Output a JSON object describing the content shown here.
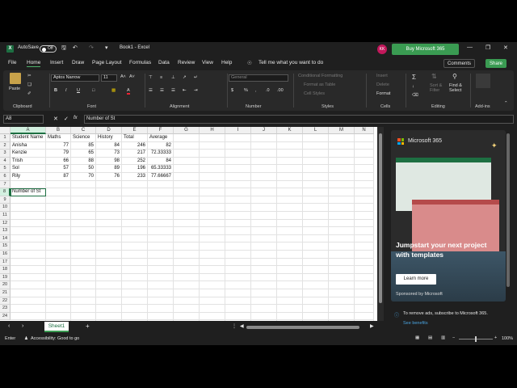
{
  "titlebar": {
    "autosave_label": "AutoSave",
    "autosave_state": "Off",
    "doc_title": "Book1 - Excel",
    "avatar_initials": "KK",
    "buy_label": "Buy Microsoft 365"
  },
  "menu": {
    "tabs": [
      "File",
      "Home",
      "Insert",
      "Draw",
      "Page Layout",
      "Formulas",
      "Data",
      "Review",
      "View",
      "Help"
    ],
    "active": "Home",
    "tell_me": "Tell me what you want to do",
    "comments": "Comments",
    "share": "Share"
  },
  "ribbon": {
    "paste": "Paste",
    "clipboard": "Clipboard",
    "font_name": "Aptos Narrow",
    "font_size": "11",
    "font": "Font",
    "alignment": "Alignment",
    "number_format": "General",
    "number": "Number",
    "conditional_formatting": "Conditional Formatting",
    "format_as_table": "Format as Table",
    "cell_styles": "Cell Styles",
    "styles": "Styles",
    "insert": "Insert",
    "delete": "Delete",
    "format": "Format",
    "cells": "Cells",
    "sort_filter": "Sort & Filter",
    "find_select": "Find & Select",
    "editing": "Editing",
    "addins": "Add-ins"
  },
  "formula_bar": {
    "name_box": "A8",
    "fx": "fx",
    "content": "Number of St"
  },
  "sheet": {
    "columns": [
      "A",
      "B",
      "C",
      "D",
      "E",
      "F",
      "G",
      "H",
      "I",
      "J",
      "K",
      "L",
      "M",
      "N"
    ],
    "row_count": 24,
    "headers": [
      "Student Name",
      "Maths",
      "Science",
      "History",
      "Total",
      "Average"
    ],
    "rows": [
      [
        "Anisha",
        "77",
        "85",
        "84",
        "246",
        "82"
      ],
      [
        "Kenzie",
        "79",
        "65",
        "73",
        "217",
        "72.33333"
      ],
      [
        "Trish",
        "66",
        "88",
        "98",
        "252",
        "84"
      ],
      [
        "Sol",
        "57",
        "50",
        "89",
        "196",
        "65.33333"
      ],
      [
        "Rily",
        "87",
        "70",
        "76",
        "233",
        "77.66667"
      ]
    ],
    "a8": "Number of St"
  },
  "tabs": {
    "sheet1": "Sheet1"
  },
  "status": {
    "mode": "Enter",
    "accessibility": "Accessibility: Good to go",
    "zoom": "100%"
  },
  "pane": {
    "brand": "Microsoft 365",
    "headline": "Jumpstart your next project with templates",
    "learn_more": "Learn more",
    "sponsored": "Sponsored by Microsoft",
    "remove_ads": "To remove ads, subscribe to Microsoft 365.",
    "see_benefits": "See benefits"
  },
  "colors": {
    "accent": "#3a9b52",
    "tab_underline": "#4cb06a",
    "window_bg": "#1f1f1f"
  }
}
